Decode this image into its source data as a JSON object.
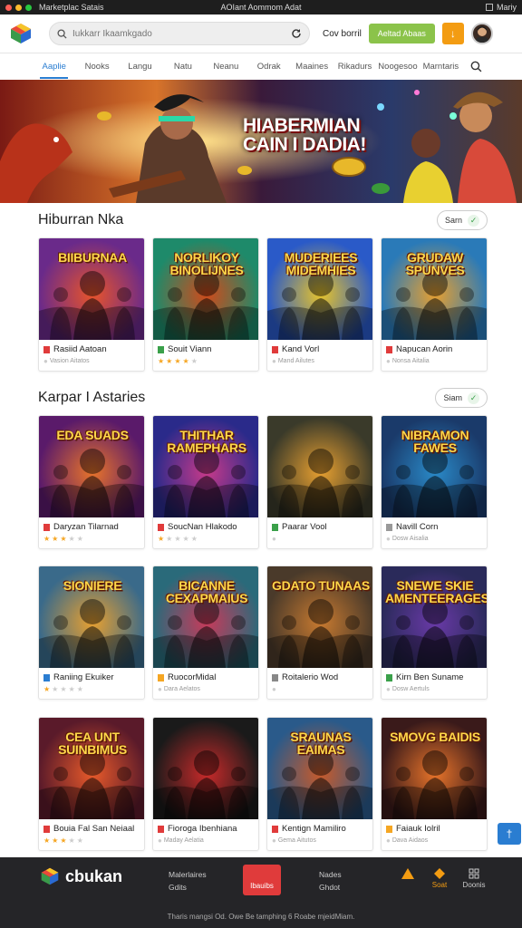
{
  "titlebar": {
    "app_name": "Marketplac Satais",
    "center": "AOIant Aommom Adat",
    "right_label": "Mariy"
  },
  "toolbar": {
    "search_placeholder": "Iukkarr Ikaamkgado",
    "link_label": "Cov borril",
    "green_button": "Aeltad Abaas"
  },
  "tabs": [
    {
      "label": "Aaplie",
      "active": true
    },
    {
      "label": "Nooks",
      "active": false
    },
    {
      "label": "Langu",
      "active": false
    },
    {
      "label": "Natu",
      "active": false
    },
    {
      "label": "Neanu",
      "active": false
    },
    {
      "label": "Odrak",
      "active": false
    },
    {
      "label": "Maaines",
      "active": false
    },
    {
      "label": "Rikadurs",
      "active": false
    },
    {
      "label": "Noogesoo",
      "active": false
    },
    {
      "label": "Marntaris",
      "active": false
    }
  ],
  "banner": {
    "title": "HIABERMIAN CAIN I DADIA!"
  },
  "sections": [
    {
      "title": "Hiburran Nka",
      "see_label": "Sarn",
      "games": [
        {
          "thumb_text": "BIIBURNAA",
          "name": "Rasiid Aatoan",
          "meta": "Vasion Aitatos",
          "icon_color": "#e03b3b",
          "stars": 0,
          "theme": [
            "#6a2a8a",
            "#e8542a"
          ]
        },
        {
          "thumb_text": "NORLIKOY BINOLIJNES",
          "name": "Souit Viann",
          "meta": "",
          "icon_color": "#3aa04a",
          "stars": 4,
          "theme": [
            "#1e8a6a",
            "#d04a1a"
          ]
        },
        {
          "thumb_text": "MUDERIEES MIDEMHIES",
          "name": "Kand Vorl",
          "meta": "Mand Ailutes",
          "icon_color": "#e03b3b",
          "stars": 0,
          "theme": [
            "#2a5ac8",
            "#e8c42a"
          ]
        },
        {
          "thumb_text": "GRUDAW SPUNVES",
          "name": "Napucan Aorin",
          "meta": "Nonsa Aitalia",
          "icon_color": "#e03b3b",
          "stars": 0,
          "theme": [
            "#2a7ab8",
            "#e8a030"
          ]
        }
      ]
    },
    {
      "title": "Karpar I Astaries",
      "see_label": "Siam",
      "games": [
        {
          "thumb_text": "EDA SUADS",
          "name": "Daryzan Tilarnad",
          "meta": "",
          "icon_color": "#e03b3b",
          "stars": 3,
          "theme": [
            "#5a1a6a",
            "#e8742a"
          ]
        },
        {
          "thumb_text": "THITHAR RAMEPHARS",
          "name": "SoucNan Hlakodo",
          "meta": "",
          "icon_color": "#e03b3b",
          "stars": 1,
          "theme": [
            "#2a2a8a",
            "#c83a8a"
          ]
        },
        {
          "thumb_text": "",
          "name": "Paarar Vool",
          "meta": "",
          "icon_color": "#3aa04a",
          "stars": 0,
          "theme": [
            "#3a3a2a",
            "#e8a030"
          ]
        },
        {
          "thumb_text": "NIBRAMON FAWES",
          "name": "Navill Corn",
          "meta": "Dosw Aisalia",
          "icon_color": "#999999",
          "stars": 0,
          "theme": [
            "#1a3a6a",
            "#2a8ac8"
          ]
        }
      ]
    },
    {
      "title": "",
      "see_label": "",
      "games": [
        {
          "thumb_text": "SIONIERE",
          "name": "Raniing Ekuiker",
          "meta": "",
          "icon_color": "#2a7dd1",
          "stars": 1,
          "theme": [
            "#3a6a8a",
            "#e8a030"
          ]
        },
        {
          "thumb_text": "BICANNE CEXAPMAIUS",
          "name": "RuocorMidal",
          "meta": "Dara Aelatos",
          "icon_color": "#f5a623",
          "stars": 0,
          "theme": [
            "#2a6a7a",
            "#c83a5a"
          ]
        },
        {
          "thumb_text": "GDATO TUNAAS",
          "name": "Roitalerio Wod",
          "meta": "",
          "icon_color": "#888888",
          "stars": 0,
          "theme": [
            "#4a3a2a",
            "#c87a30"
          ]
        },
        {
          "thumb_text": "SNEWE SKIE AMENTEERAGES",
          "name": "Kirn Ben Suname",
          "meta": "Dosw Aertuls",
          "icon_color": "#3aa04a",
          "stars": 0,
          "theme": [
            "#2a2a5a",
            "#6a3aa8"
          ]
        }
      ]
    },
    {
      "title": "",
      "see_label": "",
      "games": [
        {
          "thumb_text": "CEA UNT SUINBIMUS",
          "name": "Bouia Fal San Neiaal",
          "meta": "",
          "icon_color": "#e03b3b",
          "stars": 3,
          "theme": [
            "#5a1a2a",
            "#e85a2a"
          ]
        },
        {
          "thumb_text": "",
          "name": "Fioroga Ibenhiana",
          "meta": "Maday Aelatia",
          "icon_color": "#e03b3b",
          "stars": 0,
          "theme": [
            "#1a1a1a",
            "#c82a2a"
          ]
        },
        {
          "thumb_text": "SRAUNAS EAIMAS",
          "name": "Kentign Mamiliro",
          "meta": "Gema Aitutos",
          "icon_color": "#e03b3b",
          "stars": 0,
          "theme": [
            "#2a5a8a",
            "#c85a2a"
          ]
        },
        {
          "thumb_text": "SMOVG BAIDIS",
          "name": "Faiauk Iolril",
          "meta": "Dava Aidaos",
          "icon_color": "#f5a623",
          "stars": 0,
          "theme": [
            "#3a1a1a",
            "#e8742a"
          ]
        }
      ]
    }
  ],
  "footer": {
    "brand": "cbukan",
    "col1": [
      "Malerlaires",
      "Gdits"
    ],
    "red_button": "Ibauibs",
    "col2": [
      "Nades",
      "Ghdot"
    ],
    "item_orange": "Soat",
    "item_doc": "Doonis",
    "copyright": "Tharis mangsi Od. Owe Be tamphing 6 Roabe mjeidMiam."
  },
  "colors": {
    "accent_blue": "#2a7dd1",
    "green": "#8bc34a",
    "orange": "#f39c12",
    "footer_bg": "#252528",
    "red": "#e03b3b"
  }
}
